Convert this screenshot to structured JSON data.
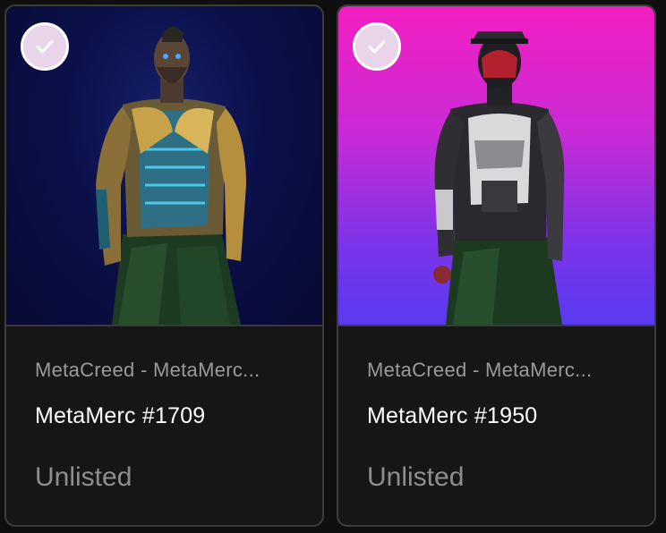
{
  "cards": [
    {
      "collection": "MetaCreed - MetaMerc...",
      "name": "MetaMerc #1709",
      "status": "Unlisted",
      "selected": true,
      "select_icon": "checkmark-icon",
      "image": "character-avatar-gold-armor",
      "background_colors": [
        "#0b1049",
        "#16206a"
      ]
    },
    {
      "collection": "MetaCreed - MetaMerc...",
      "name": "MetaMerc #1950",
      "status": "Unlisted",
      "selected": true,
      "select_icon": "checkmark-icon",
      "image": "character-avatar-tactical-armor",
      "background_colors": [
        "#f31fc2",
        "#5a3af0"
      ]
    }
  ],
  "colors": {
    "card_background": "#161616",
    "card_border": "#3c3c3c",
    "check_fill": "#e8d5ea",
    "title_text": "#ffffff",
    "secondary_text": "#9a9a9e"
  }
}
